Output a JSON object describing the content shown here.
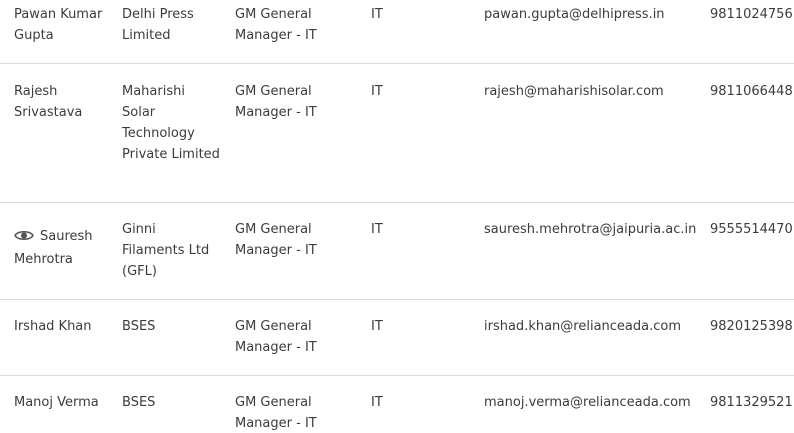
{
  "rows": [
    {
      "name": "Pawan Kumar Gupta",
      "organization": "Delhi Press Limited",
      "designation": "GM General Manager - IT",
      "department": "IT",
      "email": "pawan.gupta@delhipress.in",
      "phone": "9811024756"
    },
    {
      "name": "Rajesh Srivastava",
      "organization": "Maharishi Solar Technology Private Limited",
      "designation": "GM General Manager - IT",
      "department": "IT",
      "email": "rajesh@maharishisolar.com",
      "phone": "9811066448"
    },
    {
      "name": "Sauresh Mehrotra",
      "name_icon": "eye-icon",
      "organization": "Ginni Filaments Ltd (GFL)",
      "designation": "GM General Manager - IT",
      "department": "IT",
      "email": "sauresh.mehrotra@jaipuria.ac.in",
      "phone": "9555514470"
    },
    {
      "name": "Irshad Khan",
      "organization": "BSES",
      "designation": "GM General Manager - IT",
      "department": "IT",
      "email": "irshad.khan@relianceada.com",
      "phone": "9820125398"
    },
    {
      "name": "Manoj Verma",
      "organization": "BSES",
      "designation": "GM General Manager - IT",
      "department": "IT",
      "email": "manoj.verma@relianceada.com",
      "phone": "9811329521"
    }
  ],
  "colors": {
    "text": "#3c3c3c",
    "divider": "#dcdcdc"
  }
}
